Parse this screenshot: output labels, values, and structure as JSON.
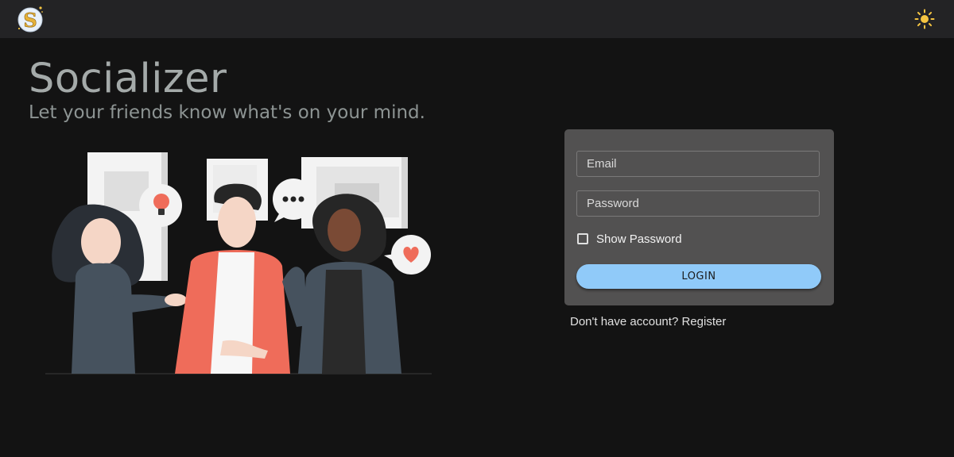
{
  "app": {
    "logo_letter": "S",
    "theme_icon": "sun-icon"
  },
  "hero": {
    "title": "Socializer",
    "tagline": "Let your friends know what's on your mind."
  },
  "login": {
    "email_placeholder": "Email",
    "password_placeholder": "Password",
    "show_password_label": "Show Password",
    "show_password_checked": false,
    "login_button": "LOGIN"
  },
  "register": {
    "prompt": "Don't have account? ",
    "link": "Register"
  },
  "colors": {
    "accent": "#90caf9",
    "background": "#131313",
    "topbar": "#232325",
    "card": "#525151",
    "sun": "#f5c542"
  }
}
